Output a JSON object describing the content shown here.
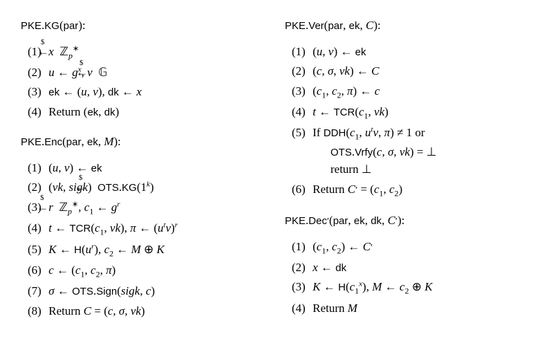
{
  "left": {
    "kg": {
      "title_html": "<span class='sans'>PKE</span>.<span class='sans'>KG</span>(<span class='sans'>par</span>):",
      "steps": [
        "<i>x</i> <span class='rla'><span class='dollar'>$</span>←</span> ℤ<sub><i>p</i></sub><sup>∗</sup>",
        "<i>u</i> ← <i>g</i><sup><i>x</i></sup>, <i>v</i> <span class='rla'><span class='dollar'>$</span>←</span> 𝔾",
        "<span class='sans'>ek</span> ← (<i>u</i>, <i>v</i>), <span class='sans'>dk</span> ← <i>x</i>",
        "Return (<span class='sans'>ek</span>, <span class='sans'>dk</span>)"
      ]
    },
    "enc": {
      "title_html": "<span class='sans'>PKE</span>.<span class='sans'>Enc</span>(<span class='sans'>par</span>, <span class='sans'>ek</span>, <i>M</i>):",
      "steps": [
        "(<i>u</i>, <i>v</i>) ← <span class='sans'>ek</span>",
        "(<i>vk</i>, <i>sigk</i>) <span class='rla'><span class='dollar'>$</span>←</span> <span class='sans'>OTS</span>.<span class='sans'>KG</span>(1<sup><i>k</i></sup>)",
        "<i>r</i> <span class='rla'><span class='dollar'>$</span>←</span> ℤ<sub><i>p</i></sub><sup>∗</sup>, <i>c</i><sub>1</sub> ← <i>g</i><sup><i>r</i></sup>",
        "<i>t</i> ← <span class='sans'>TCR</span>(<i>c</i><sub>1</sub>, <i>vk</i>), <i>π</i> ← (<i>u</i><sup><i>t</i></sup><i>v</i>)<sup><i>r</i></sup>",
        "<i>K</i> ← <span class='sans'>H</span>(<i>u</i><sup><i>r</i></sup>), <i>c</i><sub>2</sub> ← <i>M</i> ⊕ <i>K</i>",
        "<i>c</i> ← (<i>c</i><sub>1</sub>, <i>c</i><sub>2</sub>, <i>π</i>)",
        "<i>σ</i> ← <span class='sans'>OTS</span>.<span class='sans'>Sign</span>(<i>sigk</i>, <i>c</i>)",
        "Return <i>C</i> = (<i>c</i>, <i>σ</i>, <i>vk</i>)"
      ]
    }
  },
  "right": {
    "ver": {
      "title_html": "<span class='sans'>PKE</span>.<span class='sans'>Ver</span>(<span class='sans'>par</span>, <span class='sans'>ek</span>, <i>C</i>):",
      "steps": [
        "(<i>u</i>, <i>v</i>) ← <span class='sans'>ek</span>",
        "(<i>c</i>, <i>σ</i>, <i>vk</i>) ← <i>C</i>",
        "(<i>c</i><sub>1</sub>, <i>c</i><sub>2</sub>, <i>π</i>) ← <i>c</i>",
        "<i>t</i> ← <span class='sans'>TCR</span>(<i>c</i><sub>1</sub>, <i>vk</i>)",
        "If <span class='sans'>DDH</span>(<i>c</i><sub>1</sub>, <i>u</i><sup><i>t</i></sup><i>v</i>, <i>π</i>) ≠ 1 or<span class='indent2'><span class='sans'>OTS</span>.<span class='sans'>Vrfy</span>(<i>c</i>, <i>σ</i>, <i>vk</i>) = ⊥</span><span class='indent2'>return ⊥</span>",
        "Return <i>C</i><span class='prime'>′</span> = (<i>c</i><sub>1</sub>, <i>c</i><sub>2</sub>)"
      ]
    },
    "dec": {
      "title_html": "<span class='sans'>PKE</span>.<span class='sans'>Dec</span><span class='prime'>′</span>(<span class='sans'>par</span>, <span class='sans'>ek</span>, <span class='sans'>dk</span>, <i>C</i><span class='prime'>′</span>):",
      "steps": [
        "(<i>c</i><sub>1</sub>, <i>c</i><sub>2</sub>) ← <i>C</i><span class='prime'>′</span>",
        "<i>x</i> ← <span class='sans'>dk</span>",
        "<i>K</i> ← <span class='sans'>H</span>(<i>c</i><sub>1</sub><sup><i>x</i></sup>), <i>M</i> ← <i>c</i><sub>2</sub> ⊕ <i>K</i>",
        "Return <i>M</i>"
      ]
    }
  }
}
